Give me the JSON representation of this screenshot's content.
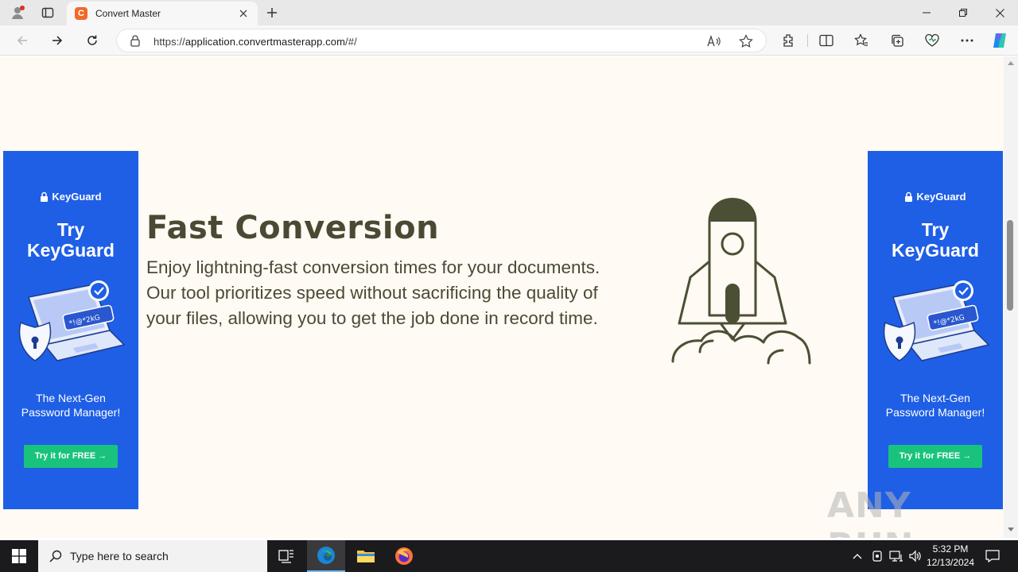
{
  "browser": {
    "tab_title": "Convert Master",
    "favicon_letter": "C",
    "url_scheme": "https://",
    "url_host": "application.convertmasterapp.com",
    "url_path": "/#/"
  },
  "page": {
    "feature": {
      "title": "Fast Conversion",
      "description": "Enjoy lightning-fast conversion times for your documents. Our tool prioritizes speed without sacrificing the quality of your files, allowing you to get the job done in record time."
    },
    "ads": [
      {
        "brand": "KeyGuard",
        "title_line1": "Try",
        "title_line2": "KeyGuard",
        "subtitle_line1": "The Next-Gen",
        "subtitle_line2": "Password Manager!",
        "cta": "Try it for FREE →",
        "password_text": "*!@*2kG"
      },
      {
        "brand": "KeyGuard",
        "title_line1": "Try",
        "title_line2": "KeyGuard",
        "subtitle_line1": "The Next-Gen",
        "subtitle_line2": "Password Manager!",
        "cta": "Try it for FREE →",
        "password_text": "*!@*2kG"
      }
    ],
    "watermark": "ANY RUN"
  },
  "taskbar": {
    "search_placeholder": "Type here to search",
    "time": "5:32 PM",
    "date": "12/13/2024"
  },
  "colors": {
    "ad_blue": "#1f5fe6",
    "cta_green": "#19c37d",
    "text_olive": "#4a4a34",
    "page_bg": "#fffaf4"
  }
}
